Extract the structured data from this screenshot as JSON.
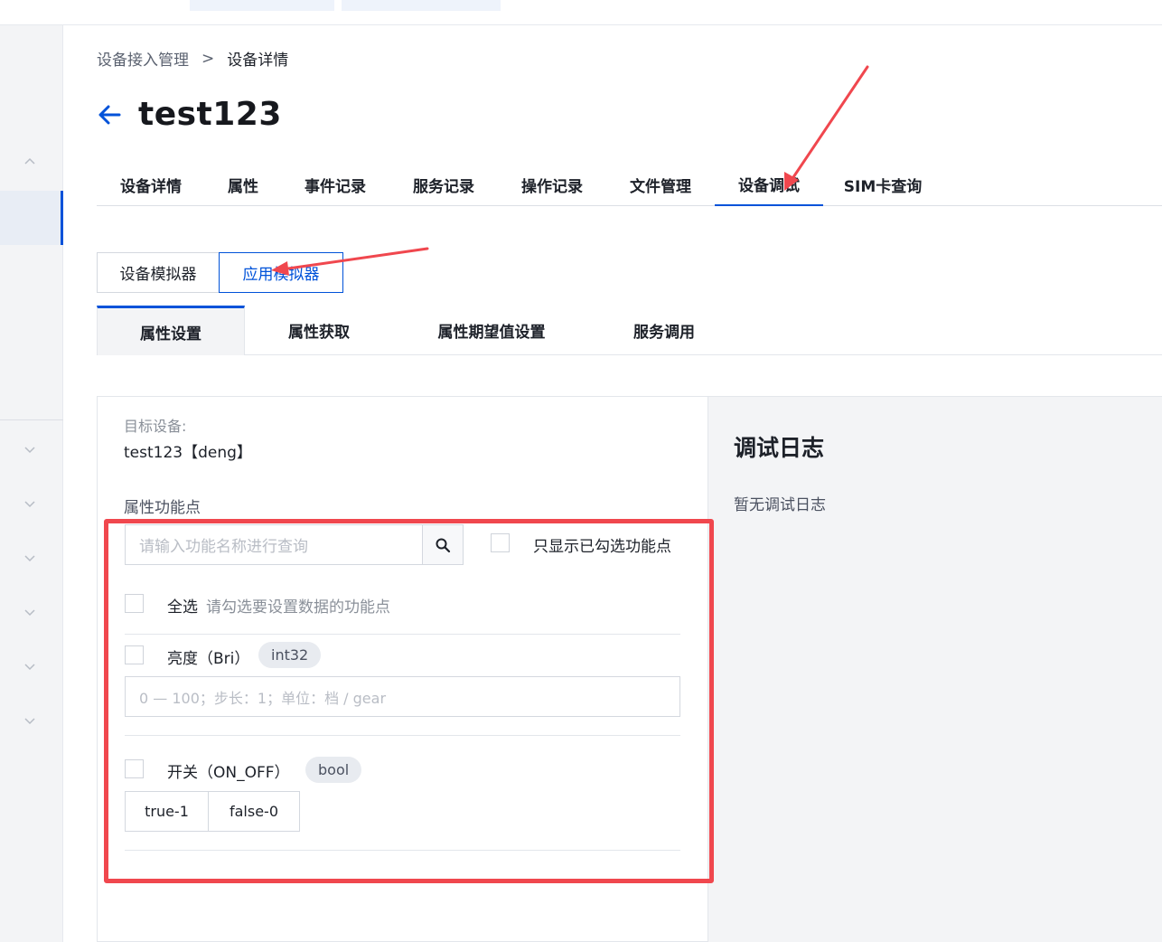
{
  "breadcrumb": {
    "parent": "设备接入管理",
    "separator": ">",
    "current": "设备详情"
  },
  "page": {
    "title": "test123"
  },
  "tabs": [
    {
      "label": "设备详情"
    },
    {
      "label": "属性"
    },
    {
      "label": "事件记录"
    },
    {
      "label": "服务记录"
    },
    {
      "label": "操作记录"
    },
    {
      "label": "文件管理"
    },
    {
      "label": "设备调试",
      "active": true
    },
    {
      "label": "SIM卡查询"
    }
  ],
  "simulator_switch": {
    "device_simulator": "设备模拟器",
    "app_simulator": "应用模拟器",
    "selected": "应用模拟器"
  },
  "subtabs": [
    {
      "label": "属性设置",
      "active": true
    },
    {
      "label": "属性获取"
    },
    {
      "label": "属性期望值设置"
    },
    {
      "label": "服务调用"
    }
  ],
  "form": {
    "target_label": "目标设备:",
    "target_value": "test123【deng】",
    "props_label": "属性功能点",
    "search_placeholder": "请输入功能名称进行查询",
    "only_checked_label": "只显示已勾选功能点",
    "select_all_label": "全选",
    "select_all_hint": "请勾选要设置数据的功能点",
    "properties": [
      {
        "name": "亮度（Bri）",
        "type": "int32",
        "input_placeholder": "0 — 100；步长：1；单位：档 / gear"
      },
      {
        "name": "开关（ON_OFF）",
        "type": "bool",
        "options": [
          "true-1",
          "false-0"
        ]
      }
    ]
  },
  "log": {
    "title": "调试日志",
    "empty": "暂无调试日志"
  },
  "colors": {
    "accent": "#0052d9",
    "annotation": "#f0474e"
  }
}
